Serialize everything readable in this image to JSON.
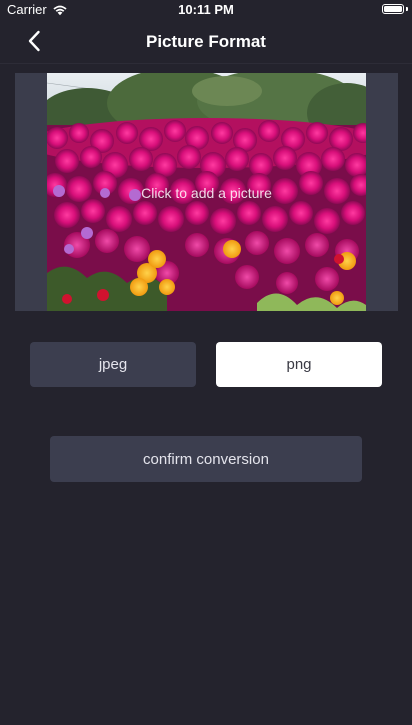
{
  "status_bar": {
    "carrier": "Carrier",
    "time": "10:11 PM",
    "wifi_icon": "wifi-icon",
    "battery_icon": "battery-icon",
    "battery_level": 1.0
  },
  "nav": {
    "title": "Picture Format",
    "back_icon": "chevron-left-icon"
  },
  "picture": {
    "hint": "Click to add a picture"
  },
  "formats": {
    "jpeg_label": "jpeg",
    "png_label": "png",
    "selected": "png"
  },
  "actions": {
    "confirm_label": "confirm conversion"
  },
  "colors": {
    "background": "#24232d",
    "button_bg": "#3c3e4f",
    "selected_bg": "#ffffff"
  }
}
